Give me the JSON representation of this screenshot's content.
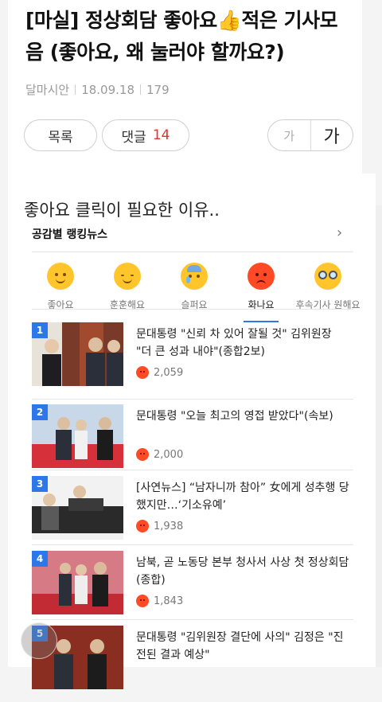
{
  "article": {
    "title_part1": "[마실] 정상회담 좋아요",
    "title_emoji": "👍",
    "title_part2": "적은 기사모음 (좋아요, 왜 눌러야 할까요?)",
    "author": "달마시안",
    "date": "18.09.18",
    "views": "179",
    "list_button": "목록",
    "comment_label": "댓글",
    "comment_count": "14",
    "font_small": "가",
    "font_large": "가"
  },
  "content": {
    "intro_text": "좋아요 클릭이 필요한 이유..",
    "ranking_title": "공감별 랭킹뉴스",
    "reactions": [
      {
        "label": "좋아요",
        "icon": "like-face-icon"
      },
      {
        "label": "훈훈해요",
        "icon": "warm-face-icon"
      },
      {
        "label": "슬퍼요",
        "icon": "sad-face-icon"
      },
      {
        "label": "화나요",
        "icon": "angry-face-icon",
        "active": true
      },
      {
        "label": "후속기사 원해요",
        "icon": "glasses-face-icon"
      }
    ],
    "news": [
      {
        "rank": "1",
        "headline": "문대통령 \"신뢰 차 있어 잘될 것\" 김위원장 \"더 큰 성과 내야\"(종합2보)",
        "count": "2,059"
      },
      {
        "rank": "2",
        "headline": "문대통령 \"오늘 최고의 영접 받았다\"(속보)",
        "count": "2,000"
      },
      {
        "rank": "3",
        "headline": "[사연뉴스] “남자니까 참아” 女에게 성추행 당했지만…‘기소유예’",
        "count": "1,938"
      },
      {
        "rank": "4",
        "headline": "남북, 곧 노동당 본부 청사서 사상 첫 정상회담(종합)",
        "count": "1,843"
      },
      {
        "rank": "5",
        "headline": "문대통령 \"김위원장 결단에 사의\" 김정은 \"진전된 결과 예상\"",
        "count": ""
      }
    ]
  },
  "colors": {
    "accent_blue": "#2c78ea",
    "comment_red": "#e2322c",
    "angry_red": "#ff4a25"
  }
}
